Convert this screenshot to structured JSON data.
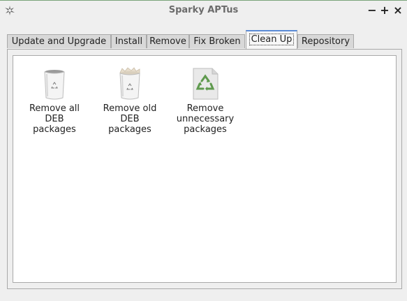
{
  "window": {
    "title": "Sparky APTus",
    "controls": {
      "minimize": "−",
      "maximize": "+",
      "close": "×"
    }
  },
  "tabs": [
    {
      "label": "Update and Upgrade",
      "active": false
    },
    {
      "label": "Install",
      "active": false
    },
    {
      "label": "Remove",
      "active": false
    },
    {
      "label": "Fix Broken",
      "active": false
    },
    {
      "label": "Clean Up",
      "active": true
    },
    {
      "label": "Repository",
      "active": false
    }
  ],
  "cleanup_items": [
    {
      "label": "Remove all\nDEB\npackages",
      "icon": "trash-can-icon"
    },
    {
      "label": "Remove old\nDEB\npackages",
      "icon": "full-trash-can-icon"
    },
    {
      "label": "Remove\nunnecessary\npackages",
      "icon": "recycle-document-icon"
    }
  ],
  "colors": {
    "tab_active_top": "#5b8bd6",
    "background": "#efefef",
    "panel_bg": "#ffffff"
  }
}
